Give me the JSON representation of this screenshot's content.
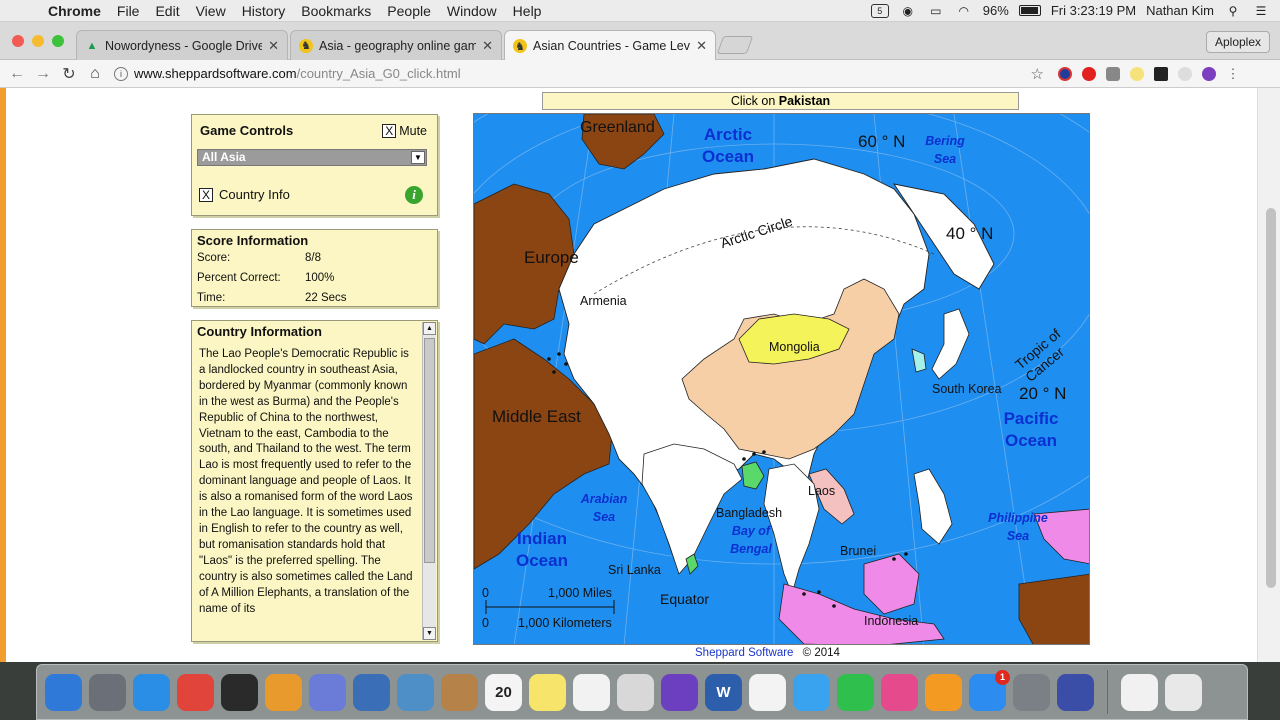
{
  "menubar": {
    "app": "Chrome",
    "items": [
      "File",
      "Edit",
      "View",
      "History",
      "Bookmarks",
      "People",
      "Window",
      "Help"
    ],
    "battery": "96%",
    "clock": "Fri 3:23:19 PM",
    "user": "Nathan Kim"
  },
  "tabs": [
    {
      "label": "Nowordyness - Google Drive",
      "icon": "google-drive-icon"
    },
    {
      "label": "Asia - geography online games",
      "icon": "sheppard-icon"
    },
    {
      "label": "Asian Countries - Game Level",
      "icon": "sheppard-icon"
    }
  ],
  "profile": "Aploplex",
  "url": {
    "host": "www.sheppardsoftware.com",
    "path": "/country_Asia_G0_click.html"
  },
  "prompt": {
    "prefix": "Click on ",
    "target": "Pakistan"
  },
  "game_controls": {
    "title": "Game Controls",
    "mute_label": "Mute",
    "mute_checked": "X",
    "region_select": "All Asia",
    "country_info_label": "Country Info",
    "country_info_checked": "X",
    "info_icon": "i"
  },
  "score": {
    "title": "Score Information",
    "rows": [
      {
        "label": "Score:",
        "value": "8/8"
      },
      {
        "label": "Percent Correct:",
        "value": "100%"
      },
      {
        "label": "Time:",
        "value": "22 Secs"
      }
    ]
  },
  "country_info": {
    "title": "Country Information",
    "text": "The Lao People's Democratic Republic is a landlocked country in southeast Asia, bordered by Myanmar (commonly known in the west as Burma) and the People's Republic of China to the northwest, Vietnam to the east, Cambodia to the south, and Thailand to the west. The term Lao is most frequently used to refer to the dominant language and people of Laos. It is also a romanised form of the word Laos in the Lao language. It is sometimes used in English to refer to the country as well, but romanisation standards hold that \"Laos\" is the preferred spelling. The country is also sometimes called the Land of A Million Elephants, a translation of the name of its"
  },
  "map": {
    "labels": {
      "greenland": "Greenland",
      "arctic_ocean": "Arctic Ocean",
      "bering_sea": "Bering Sea",
      "lat60": "60 ° N",
      "lat40": "40 ° N",
      "lat20": "20 ° N",
      "arctic_circle": "Arctic Circle",
      "europe": "Europe",
      "armenia": "Armenia",
      "mongolia": "Mongolia",
      "tropic": "Tropic of Cancer",
      "south_korea": "South Korea",
      "pacific_ocean": "Pacific Ocean",
      "middle_east": "Middle East",
      "arabian_sea": "Arabian Sea",
      "laos": "Laos",
      "bangladesh": "Bangladesh",
      "bay_of_bengal": "Bay of Bengal",
      "philippine_sea": "Philippine Sea",
      "indian_ocean": "Indian Ocean",
      "brunei": "Brunei",
      "sri_lanka": "Sri Lanka",
      "equator": "Equator",
      "scale_miles_zero": "0",
      "scale_miles": "1,000 Miles",
      "scale_km_zero": "0",
      "scale_km": "1,000 Kilometers",
      "indonesia": "Indonesia"
    },
    "colors": {
      "ocean": "#1e8ff0",
      "land": "#ffffff",
      "other_continent": "#8b4513",
      "china": "#f7cfa6",
      "mongolia": "#f5f35a",
      "highlight_green": "#5bd86a",
      "indonesia": "#f08ae8",
      "laos": "#f5c0c0"
    }
  },
  "footer": {
    "link": "Sheppard Software",
    "copyright": "© 2014"
  },
  "dock": [
    {
      "name": "finder-icon",
      "color": "#2f7ad9"
    },
    {
      "name": "launchpad-icon",
      "color": "#6a6f78"
    },
    {
      "name": "safari-icon",
      "color": "#2a8de6"
    },
    {
      "name": "chrome-icon",
      "color": "#e0443b"
    },
    {
      "name": "obs-icon",
      "color": "#2a2a2a"
    },
    {
      "name": "pages-icon",
      "color": "#e89a2c"
    },
    {
      "name": "discord-icon",
      "color": "#6b7bd8"
    },
    {
      "name": "virtualbox-icon",
      "color": "#3a6fb8"
    },
    {
      "name": "preview-icon",
      "color": "#4f8fc7"
    },
    {
      "name": "contacts-icon",
      "color": "#b5834a"
    },
    {
      "name": "calendar-icon",
      "color": "#f4f4f4",
      "text": "20"
    },
    {
      "name": "notes-icon",
      "color": "#f7e46b"
    },
    {
      "name": "reminders-icon",
      "color": "#f2f2f2"
    },
    {
      "name": "photo-booth-icon",
      "color": "#d8d8d8"
    },
    {
      "name": "imovie-icon",
      "color": "#6b3fc0"
    },
    {
      "name": "word-icon",
      "color": "#2c5eab",
      "text": "W"
    },
    {
      "name": "photos-icon",
      "color": "#f3f3f3"
    },
    {
      "name": "messages-icon",
      "color": "#39a3f0"
    },
    {
      "name": "facetime-icon",
      "color": "#2fbf4d"
    },
    {
      "name": "itunes-icon",
      "color": "#e44a8c"
    },
    {
      "name": "ibooks-icon",
      "color": "#f39a23"
    },
    {
      "name": "app-store-icon",
      "color": "#2d8cf0",
      "badge": "1"
    },
    {
      "name": "system-preferences-icon",
      "color": "#7b7f86"
    },
    {
      "name": "quicktime-icon",
      "color": "#3a4ea8"
    },
    {
      "name": "music-file-icon",
      "color": "#f1f1f1"
    },
    {
      "name": "trash-icon",
      "color": "#e8e8e8"
    }
  ]
}
